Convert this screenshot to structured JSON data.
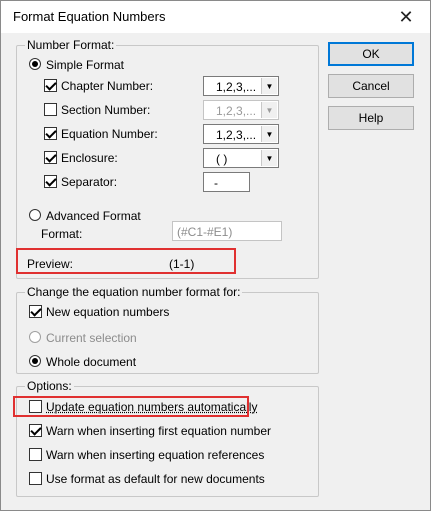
{
  "window": {
    "title": "Format Equation Numbers",
    "close_glyph": "✕"
  },
  "buttons": {
    "ok": "OK",
    "cancel": "Cancel",
    "help": "Help"
  },
  "number_format": {
    "legend": "Number Format:",
    "simple_format": {
      "label": "Simple Format",
      "selected": true
    },
    "chapter_number": {
      "label": "Chapter Number:",
      "checked": true,
      "value": "1,2,3,...",
      "enabled": true
    },
    "section_number": {
      "label": "Section Number:",
      "checked": false,
      "value": "1,2,3,...",
      "enabled": false
    },
    "equation_number": {
      "label": "Equation Number:",
      "checked": true,
      "value": "1,2,3,...",
      "enabled": true
    },
    "enclosure": {
      "label": "Enclosure:",
      "checked": true,
      "value": "( )",
      "enabled": true
    },
    "separator": {
      "label": "Separator:",
      "checked": true,
      "value": "-"
    },
    "advanced_format": {
      "label": "Advanced Format",
      "selected": false
    },
    "format": {
      "label": "Format:",
      "value": "(#C1-#E1)"
    },
    "preview": {
      "label": "Preview:",
      "value": "(1-1)"
    }
  },
  "change_scope": {
    "legend": "Change the equation number format for:",
    "new_equation_numbers": {
      "label": "New equation numbers",
      "checked": true
    },
    "current_selection": {
      "label": "Current selection",
      "selected": false,
      "enabled": false
    },
    "whole_document": {
      "label": "Whole document",
      "selected": true
    }
  },
  "options": {
    "legend": "Options:",
    "update_automatically": {
      "label": "Update equation numbers automatically",
      "checked": false
    },
    "warn_first": {
      "label": "Warn when inserting first equation number",
      "checked": true
    },
    "warn_references": {
      "label": "Warn when inserting equation references",
      "checked": false
    },
    "use_default": {
      "label": "Use format as default for new documents",
      "checked": false
    }
  },
  "colors": {
    "highlight": "#e03030",
    "default_button_border": "#0078d7"
  }
}
